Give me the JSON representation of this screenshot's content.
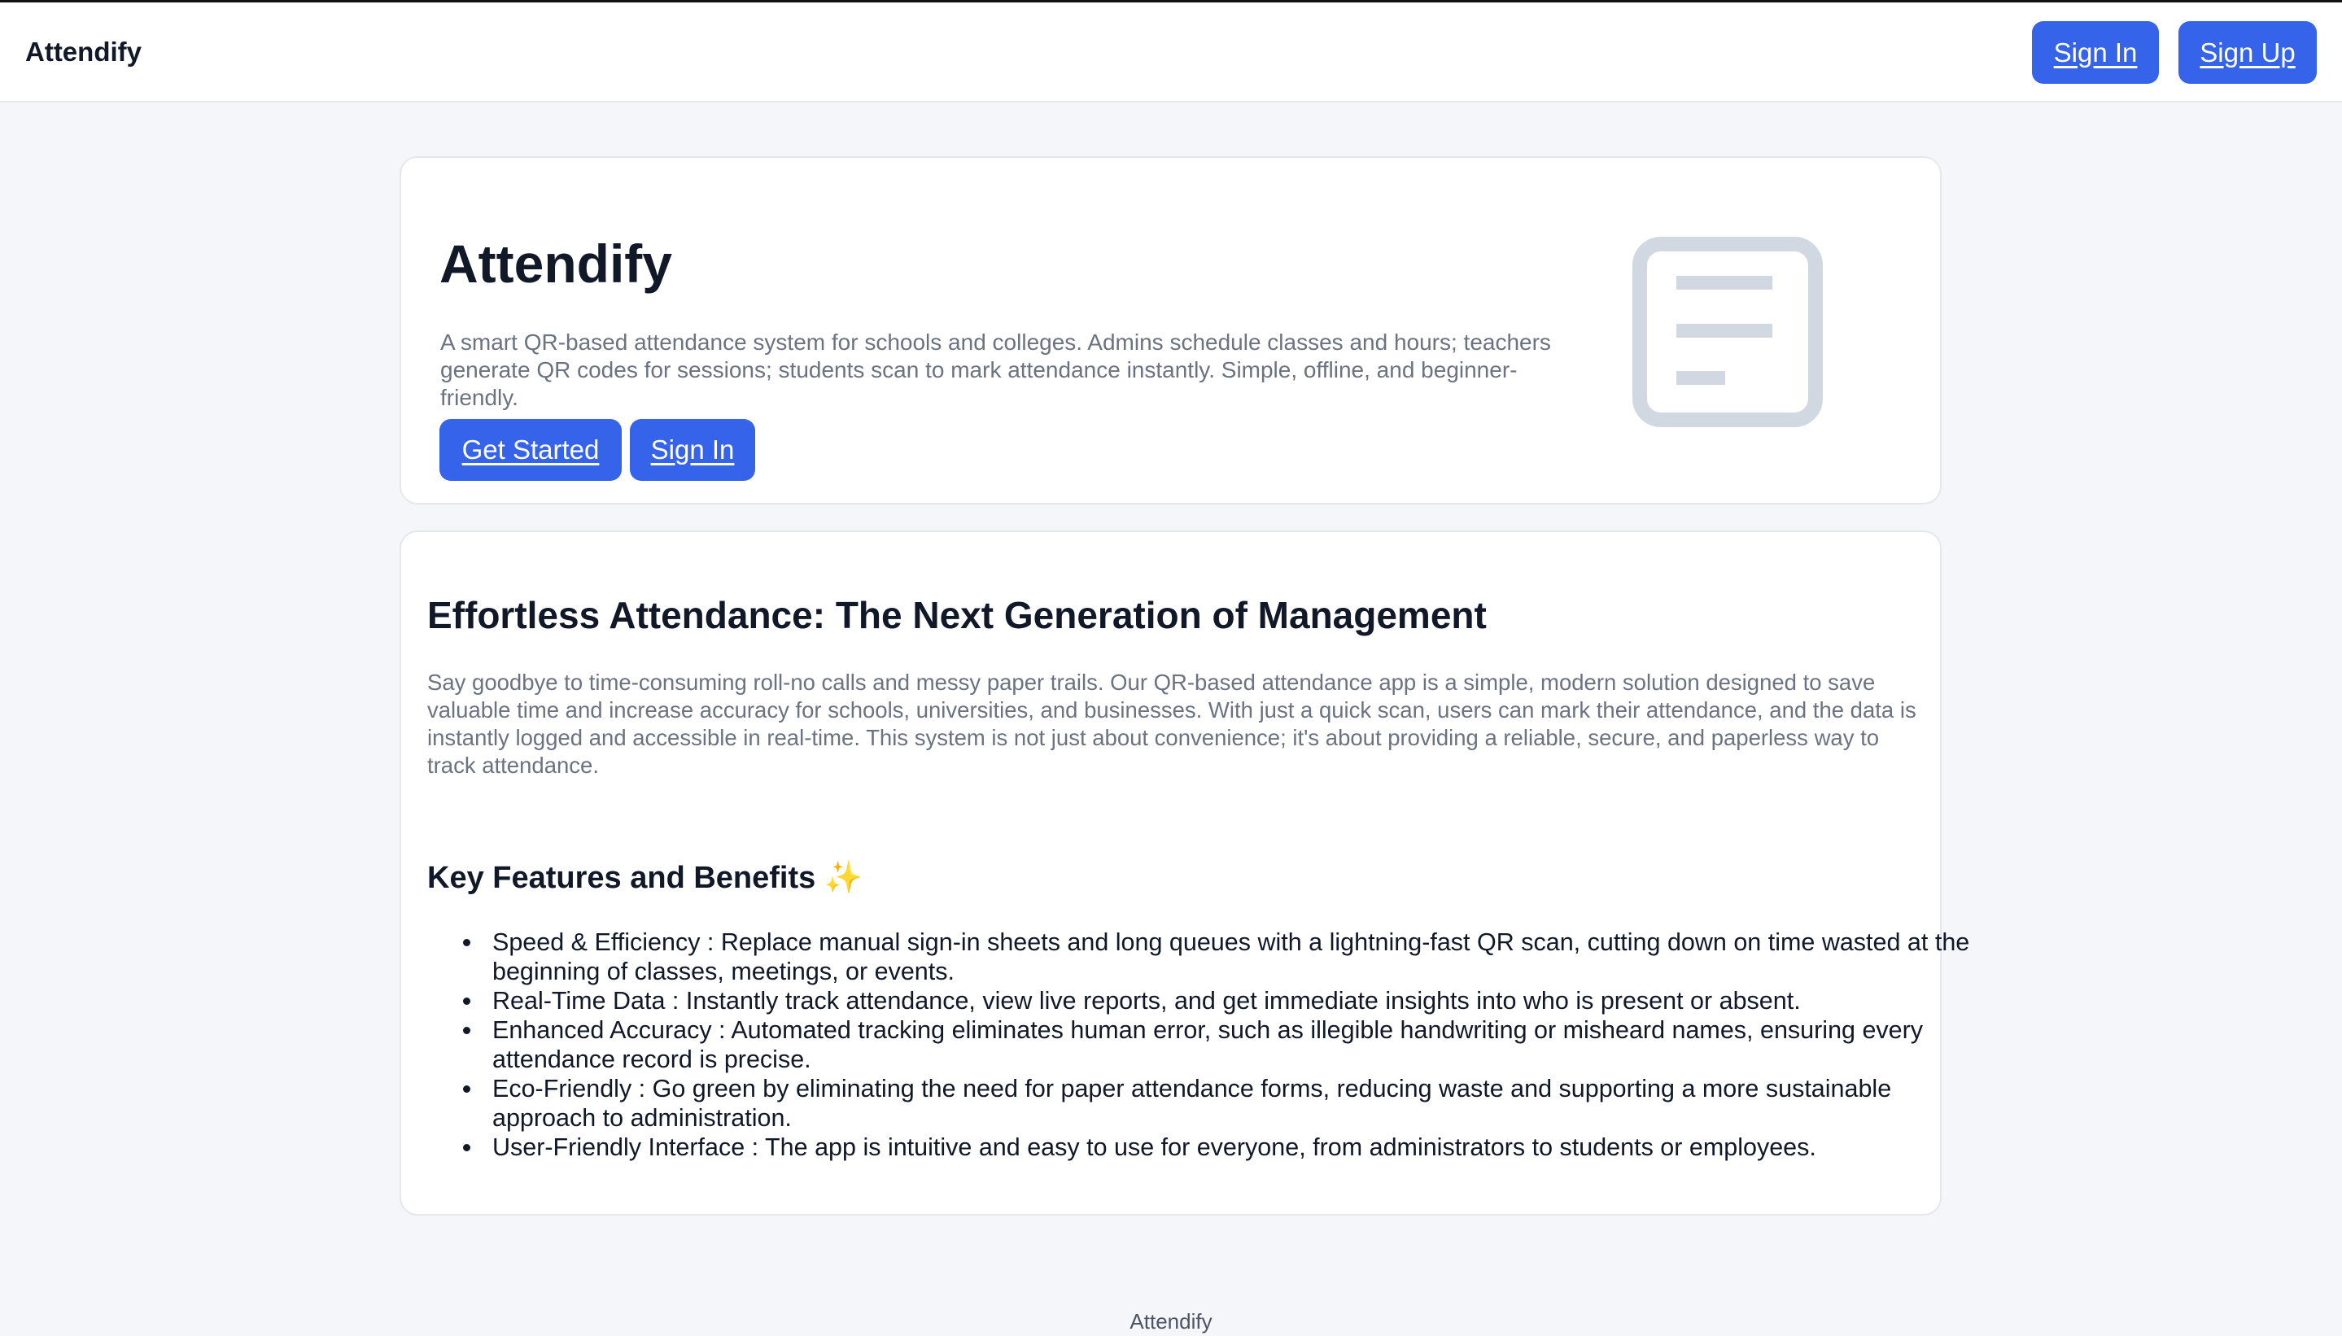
{
  "nav": {
    "brand": "Attendify",
    "signin_label": "Sign In",
    "signup_label": "Sign Up"
  },
  "hero": {
    "title": "Attendify",
    "description": "A smart QR-based attendance system for schools and colleges. Admins schedule classes and hours; teachers generate QR codes for sessions; students scan to mark attendance instantly. Simple, offline, and beginner-friendly.",
    "get_started_label": "Get Started",
    "signin_label": "Sign In",
    "icon": "document-lines-icon"
  },
  "content": {
    "title": "Effortless Attendance: The Next Generation of Management",
    "description": "Say goodbye to time-consuming roll-no calls and messy paper trails. Our QR-based attendance app is a simple, modern solution designed to save valuable time and increase accuracy for schools, universities, and businesses. With just a quick scan, users can mark their attendance, and the data is instantly logged and accessible in real-time. This system is not just about convenience; it's about providing a reliable, secure, and paperless way to track attendance.",
    "features_title": "Key Features and Benefits",
    "features_emoji": "✨",
    "features": [
      "Speed & Efficiency : Replace manual sign-in sheets and long queues with a lightning-fast QR scan, cutting down on time wasted at the beginning of classes, meetings, or events.",
      "Real-Time Data : Instantly track attendance, view live reports, and get immediate insights into who is present or absent.",
      "Enhanced Accuracy : Automated tracking eliminates human error, such as illegible handwriting or misheard names, ensuring every attendance record is precise.",
      "Eco-Friendly : Go green by eliminating the need for paper attendance forms, reducing waste and supporting a more sustainable approach to administration.",
      "User-Friendly Interface : The app is intuitive and easy to use for everyone, from administrators to students or employees."
    ]
  },
  "footer": {
    "text": "Attendify"
  },
  "colors": {
    "primary": "#3563e9",
    "background": "#f5f6fa",
    "muted_text": "#6b7280",
    "icon": "#d1d8e2"
  }
}
